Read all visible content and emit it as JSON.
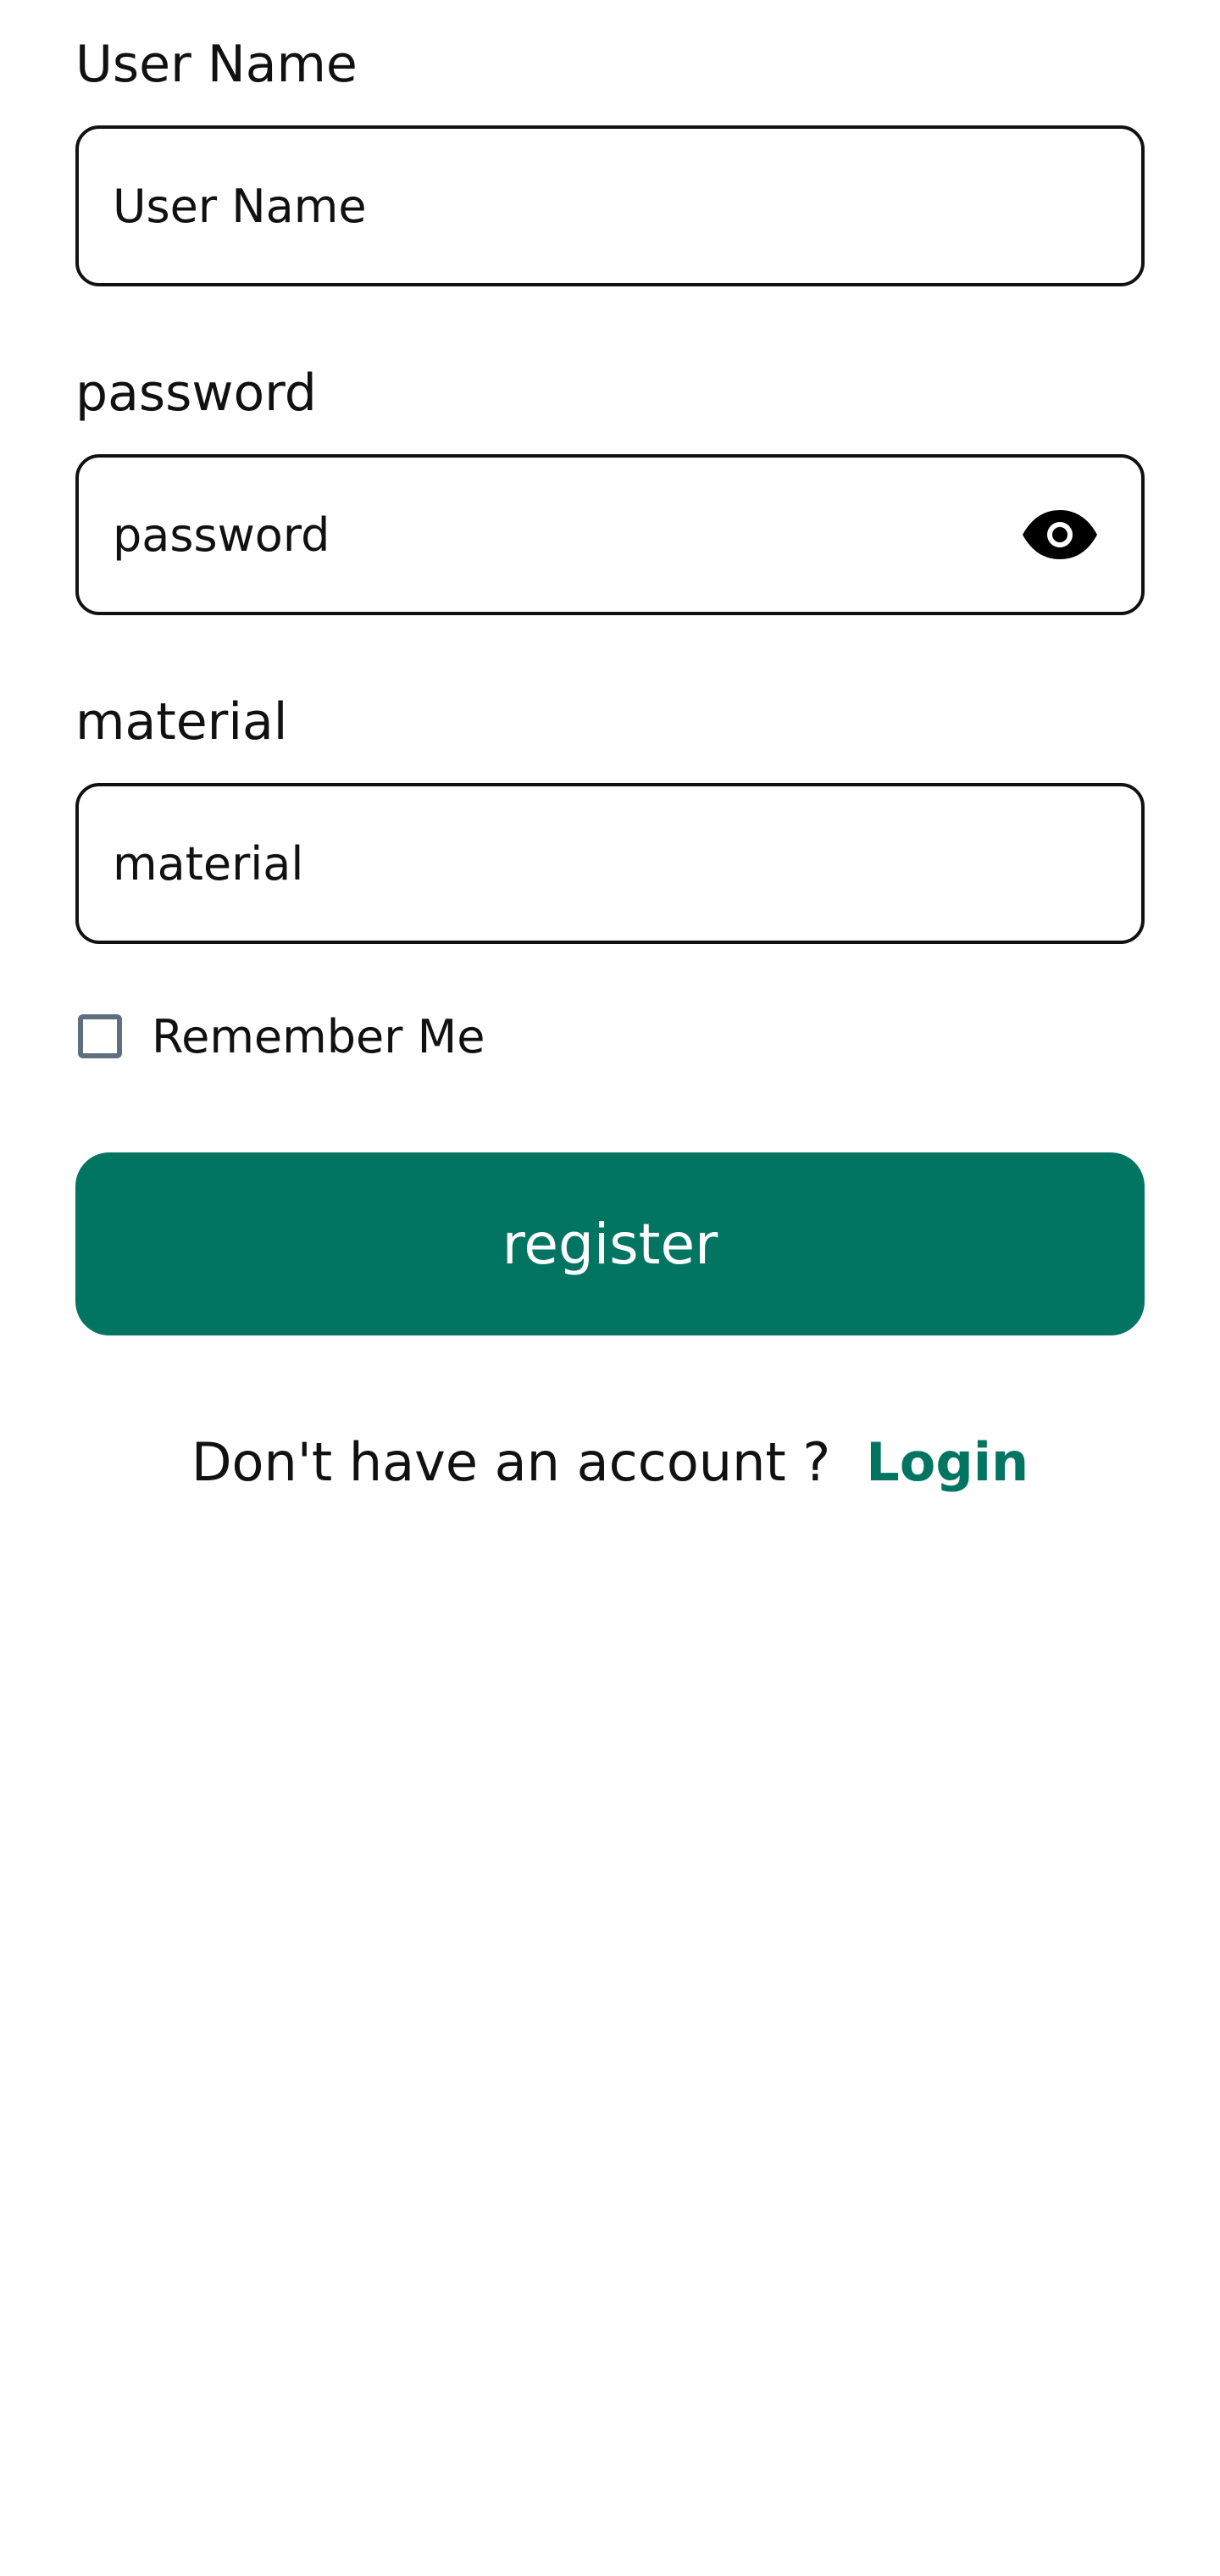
{
  "colors": {
    "accent": "#027562",
    "text": "#111111",
    "border": "#111111",
    "checkbox_border": "#5f6f80",
    "background": "#ffffff"
  },
  "fields": {
    "username": {
      "label": "User Name",
      "placeholder": "User Name",
      "value": ""
    },
    "password": {
      "label": "password",
      "placeholder": "password",
      "value": "",
      "toggle_icon": "eye-icon"
    },
    "material": {
      "label": "material",
      "placeholder": "material",
      "value": ""
    }
  },
  "remember_me": {
    "label": "Remember Me",
    "checked": false
  },
  "register_button": {
    "label": "register"
  },
  "footer": {
    "prompt": "Don't have an account ?",
    "link_label": "Login"
  }
}
